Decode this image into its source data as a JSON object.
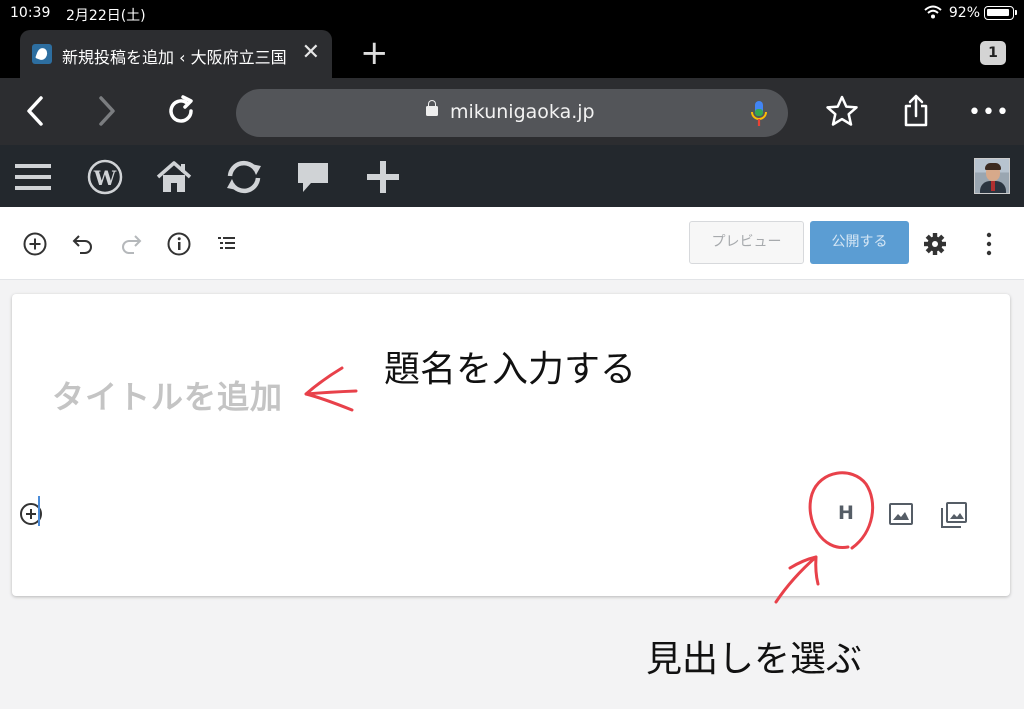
{
  "status_bar": {
    "time": "10:39",
    "date": "2月22日(土)",
    "battery": "92%"
  },
  "tabs": {
    "active_title": "新規投稿を追加 ‹ 大阪府立三国",
    "close": "✕",
    "new_tab": "+",
    "count": "1"
  },
  "browser": {
    "url": "mikunigaoka.jp",
    "more": "•••"
  },
  "editor": {
    "preview_label": "プレビュー",
    "publish_label": "公開する",
    "title_placeholder": "タイトルを追加",
    "heading_block": "H"
  },
  "annotations": {
    "title_note": "題名を入力する",
    "heading_note": "見出しを選ぶ"
  },
  "colors": {
    "publish_button": "#5b9dd3",
    "annotation_ink": "#e8414a",
    "wp_admin_bar": "#23282d"
  }
}
